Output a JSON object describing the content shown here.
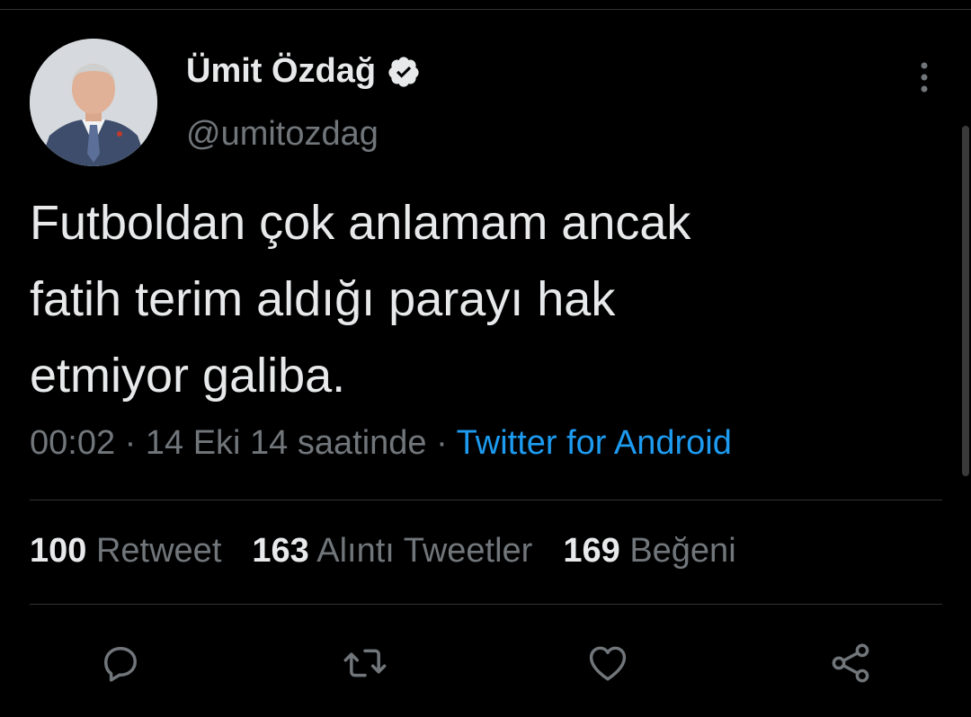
{
  "tweet": {
    "display_name": "Ümit Özdağ",
    "handle": "@umitozdag",
    "verified": true,
    "text": "Futboldan çok anlamam ancak\nfatih terim aldığı parayı hak\netmiyor galiba.",
    "time": "00:02",
    "date": "14 Eki 14 saatinde",
    "separator": "·",
    "source": "Twitter for Android"
  },
  "stats": {
    "retweets": {
      "count": "100",
      "label": "Retweet"
    },
    "quotes": {
      "count": "163",
      "label": "Alıntı Tweetler"
    },
    "likes": {
      "count": "169",
      "label": "Beğeni"
    }
  },
  "icons": {
    "verified": "verified-badge-icon",
    "more": "more-vertical-icon",
    "reply": "reply-icon",
    "retweet": "retweet-icon",
    "like": "heart-icon",
    "share": "share-icon"
  },
  "colors": {
    "background": "#000000",
    "text": "#e7e9ea",
    "secondary": "#71767b",
    "link": "#1d9bf0",
    "divider": "#2f3336"
  }
}
